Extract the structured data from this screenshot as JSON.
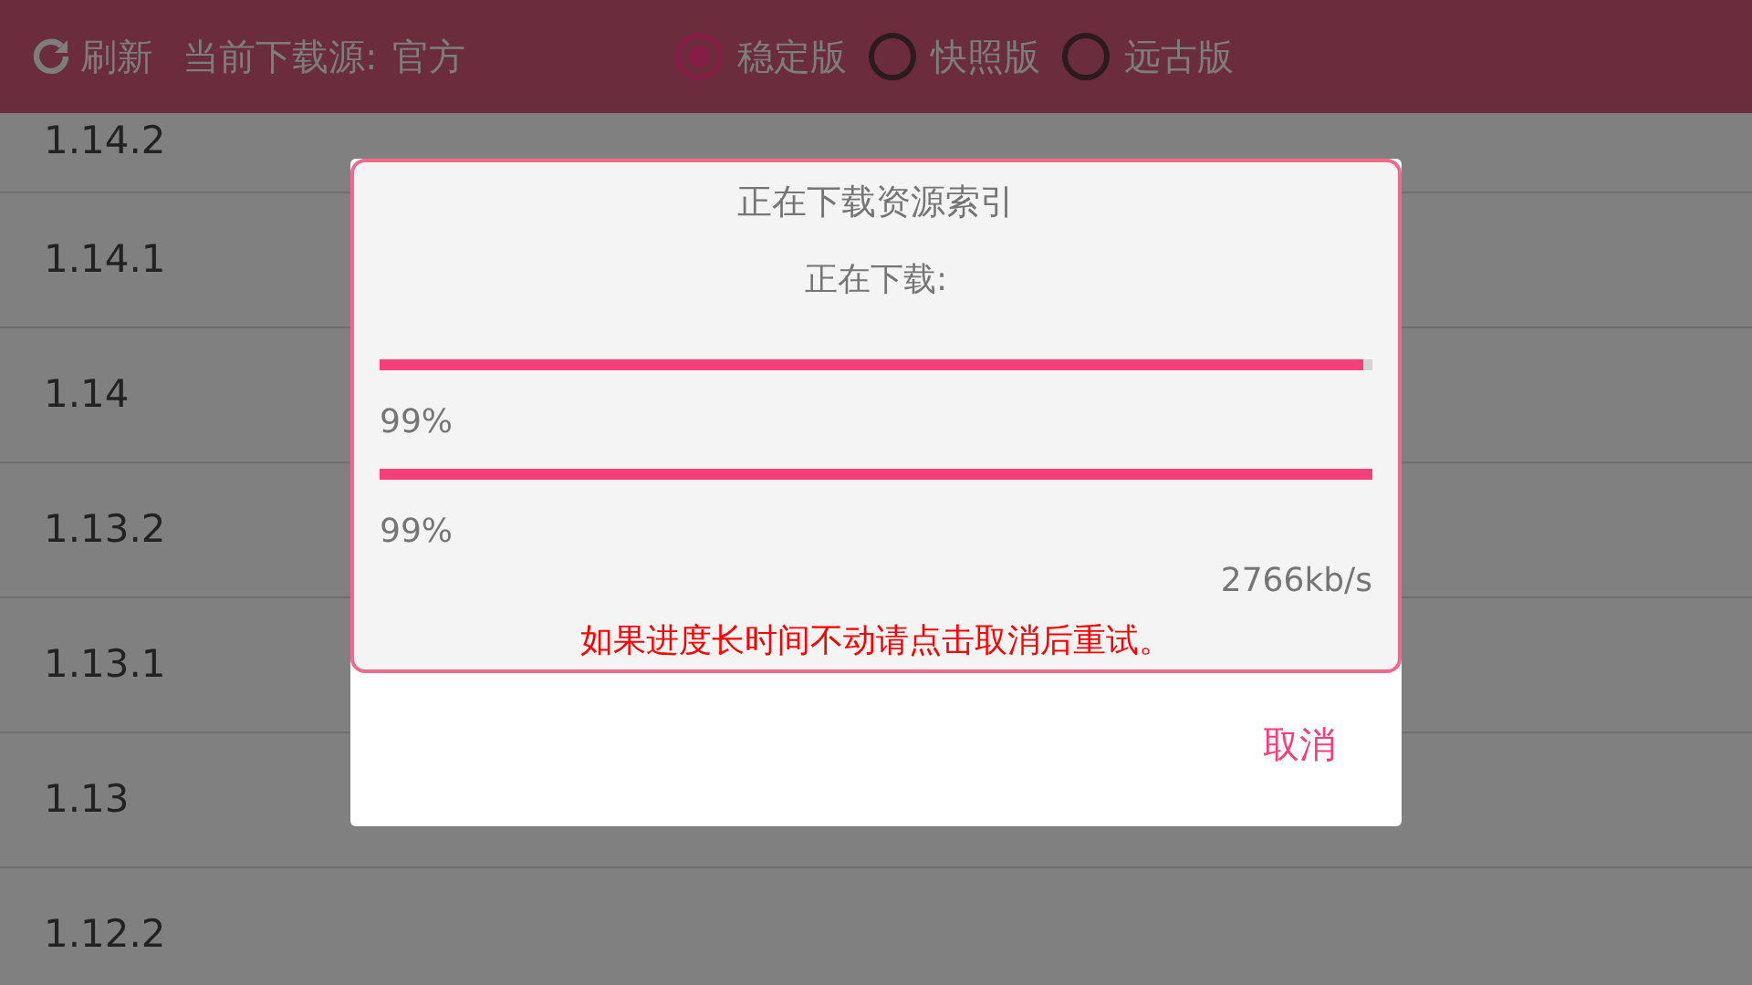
{
  "toolbar": {
    "refresh_label": "刷新",
    "source_label": "当前下载源:",
    "source_value": "官方",
    "channels": [
      {
        "label": "稳定版",
        "selected": true
      },
      {
        "label": "快照版",
        "selected": false
      },
      {
        "label": "远古版",
        "selected": false
      }
    ]
  },
  "versions": [
    "1.14.2",
    "1.14.1",
    "1.14",
    "1.13.2",
    "1.13.1",
    "1.13",
    "1.12.2"
  ],
  "dialog": {
    "title": "正在下载资源索引",
    "status": "正在下载:",
    "progress": [
      {
        "level": 0.99,
        "reading": "99%"
      },
      {
        "level": 1.0,
        "reading": "99%"
      }
    ],
    "speed": "2766kb/s",
    "warning": "如果进度长时间不动请点击取消后重试。",
    "cancel": "取消"
  }
}
